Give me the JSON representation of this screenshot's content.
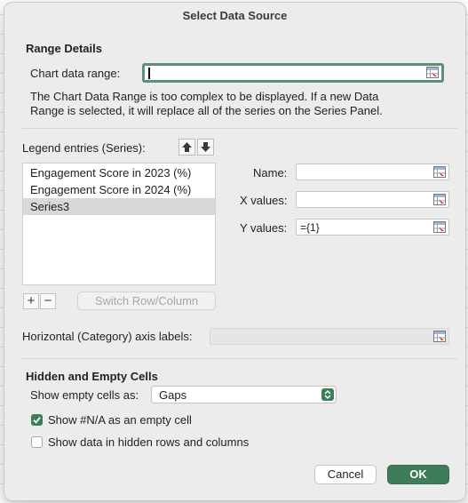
{
  "dialog": {
    "title": "Select Data Source"
  },
  "range_details": {
    "heading": "Range Details",
    "chart_data_range_label": "Chart data range:",
    "chart_data_range_value": "",
    "info_line1": "The Chart Data Range is too complex to be displayed. If a new Data",
    "info_line2": "Range is selected, it will replace all of the series on the Series Panel."
  },
  "series": {
    "legend_label": "Legend entries (Series):",
    "items": [
      {
        "label": "Engagement Score in 2023 (%)",
        "selected": false
      },
      {
        "label": "Engagement Score in 2024 (%)",
        "selected": false
      },
      {
        "label": "Series3",
        "selected": true
      }
    ],
    "add_symbol": "+",
    "remove_symbol": "−",
    "switch_label": "Switch Row/Column",
    "name_label": "Name:",
    "name_value": "",
    "x_values_label": "X values:",
    "x_values_value": "",
    "y_values_label": "Y values:",
    "y_values_value": "={1}"
  },
  "category": {
    "label": "Horizontal (Category) axis labels:",
    "value": ""
  },
  "hidden_empty": {
    "heading": "Hidden and Empty Cells",
    "show_empty_label": "Show empty cells as:",
    "show_empty_value": "Gaps",
    "show_na_label": "Show #N/A as an empty cell",
    "show_na_checked": true,
    "show_hidden_label": "Show data in hidden rows and columns",
    "show_hidden_checked": false
  },
  "buttons": {
    "cancel": "Cancel",
    "ok": "OK"
  },
  "icons": {
    "range_picker": "range-picker-icon",
    "move_up": "arrow-up-icon",
    "move_down": "arrow-down-icon",
    "dropdown": "chevron-updown-icon",
    "check": "checkmark-icon"
  },
  "colors": {
    "accent": "#3f7d5a",
    "focus_ring": "#5f8f7a",
    "selection": "#d8d8d8"
  }
}
